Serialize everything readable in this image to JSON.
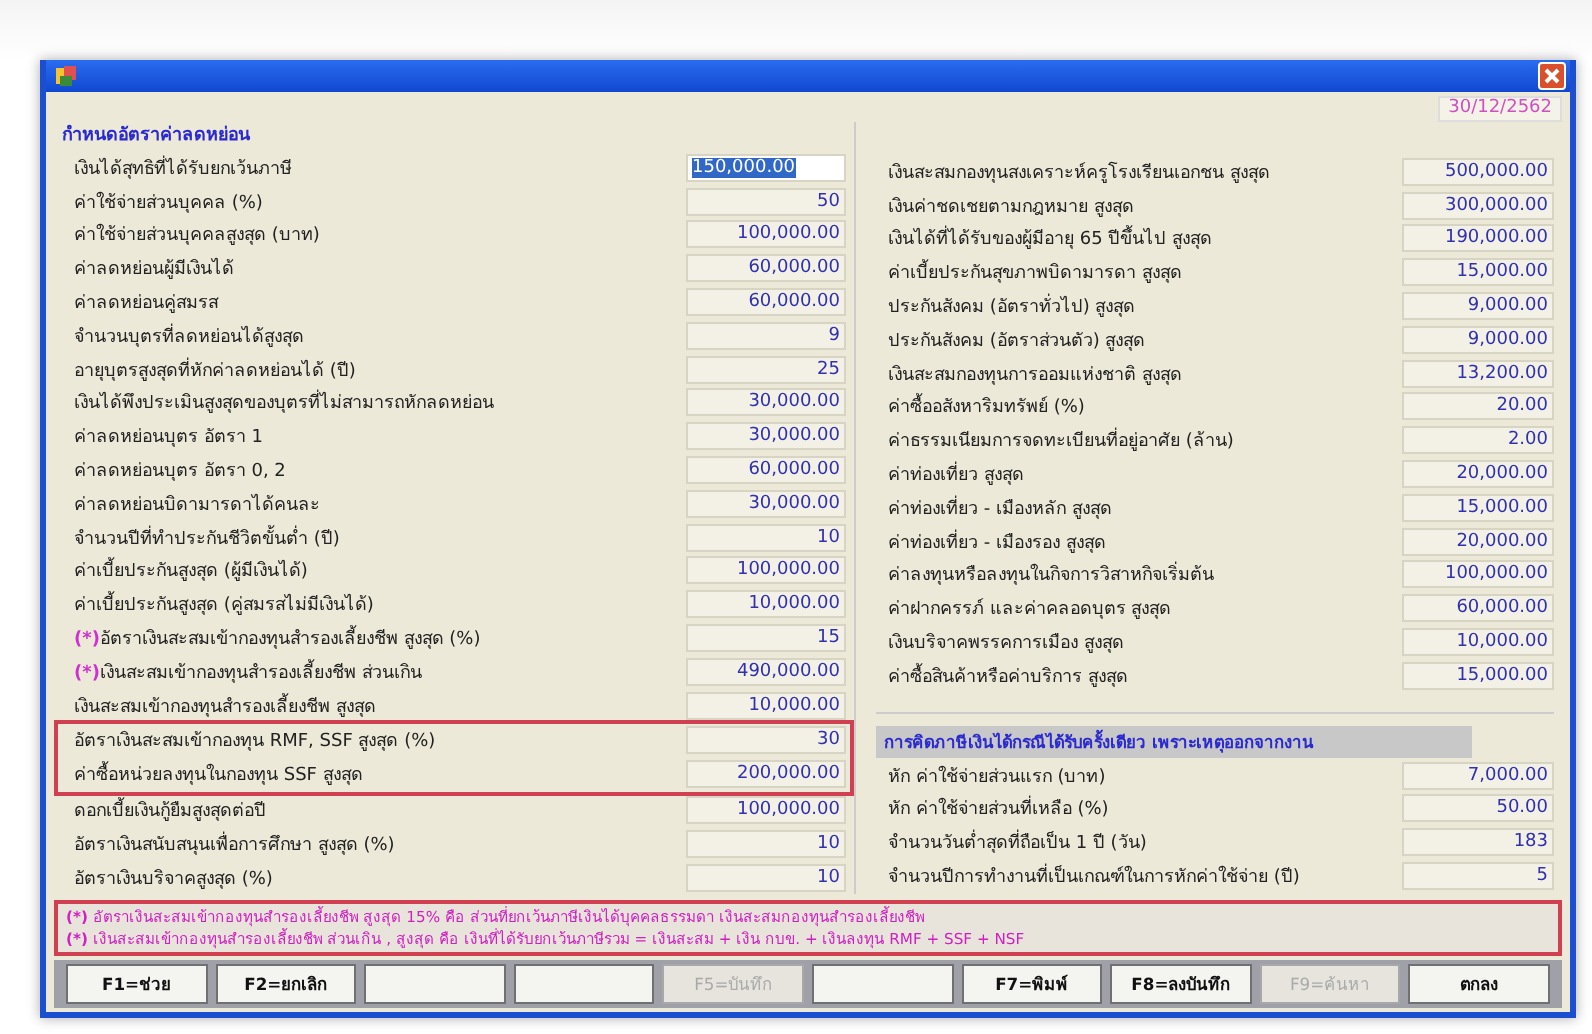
{
  "window": {
    "date": "30/12/2562"
  },
  "left_panel": {
    "title": "กำหนดอัตราค่าลดหย่อน",
    "rows": [
      {
        "label": "เงินได้สุทธิที่ได้รับยกเว้นภาษี",
        "value": "150,000.00",
        "selected": true
      },
      {
        "label": "ค่าใช้จ่ายส่วนบุคคล (%)",
        "value": "50",
        "selected": false
      },
      {
        "label": "ค่าใช้จ่ายส่วนบุคคลสูงสุด (บาท)",
        "value": "100,000.00",
        "selected": false
      },
      {
        "label": "ค่าลดหย่อนผู้มีเงินได้",
        "value": "60,000.00",
        "selected": false
      },
      {
        "label": "ค่าลดหย่อนคู่สมรส",
        "value": "60,000.00",
        "selected": false
      },
      {
        "label": "จำนวนบุตรที่ลดหย่อนได้สูงสุด",
        "value": "9",
        "selected": false
      },
      {
        "label": "อายุบุตรสูงสุดที่หักค่าลดหย่อนได้ (ปี)",
        "value": "25",
        "selected": false
      },
      {
        "label": "เงินได้พึงประเมินสูงสุดของบุตรที่ไม่สามารถหักลดหย่อน",
        "value": "30,000.00",
        "selected": false
      },
      {
        "label": "ค่าลดหย่อนบุตร อัตรา 1",
        "value": "30,000.00",
        "selected": false
      },
      {
        "label": "ค่าลดหย่อนบุตร อัตรา 0, 2",
        "value": "60,000.00",
        "selected": false
      },
      {
        "label": "ค่าลดหย่อนบิดามารดาได้คนละ",
        "value": "30,000.00",
        "selected": false
      },
      {
        "label": "จำนวนปีที่ทำประกันชีวิตขั้นต่ำ (ปี)",
        "value": "10",
        "selected": false
      },
      {
        "label": "ค่าเบี้ยประกันสูงสุด (ผู้มีเงินได้)",
        "value": "100,000.00",
        "selected": false
      },
      {
        "label": "ค่าเบี้ยประกันสูงสุด (คู่สมรสไม่มีเงินได้)",
        "value": "10,000.00",
        "selected": false
      },
      {
        "mark": "(*)",
        "label": "อัตราเงินสะสมเข้ากองทุนสำรองเลี้ยงชีพ สูงสุด (%)",
        "value": "15",
        "selected": false
      },
      {
        "mark": "(*)",
        "label": "เงินสะสมเข้ากองทุนสำรองเลี้ยงชีพ ส่วนเกิน",
        "value": "490,000.00",
        "selected": false
      },
      {
        "label": "เงินสะสมเข้ากองทุนสำรองเลี้ยงชีพ สูงสุด",
        "value": "10,000.00",
        "selected": false
      },
      {
        "kind": "highlight_group",
        "rows": [
          {
            "label": "อัตราเงินสะสมเข้ากองทุน RMF, SSF สูงสุด (%)",
            "value": "30",
            "selected": false
          },
          {
            "label": "ค่าซื้อหน่วยลงทุนในกองทุน SSF สูงสุด",
            "value": "200,000.00",
            "selected": false
          }
        ]
      },
      {
        "label": "ดอกเบี้ยเงินกู้ยืมสูงสุดต่อปี",
        "value": "100,000.00",
        "selected": false
      },
      {
        "label": "อัตราเงินสนับสนุนเพื่อการศึกษา สูงสุด (%)",
        "value": "10",
        "selected": false
      },
      {
        "label": "อัตราเงินบริจาคสูงสุด (%)",
        "value": "10",
        "selected": false
      }
    ]
  },
  "right_panel": {
    "rows": [
      {
        "kind": "field",
        "label": "เงินสะสมกองทุนสงเคราะห์ครูโรงเรียนเอกชน สูงสุด",
        "value": "500,000.00"
      },
      {
        "kind": "field",
        "label": "เงินค่าชดเชยตามกฎหมาย สูงสุด",
        "value": "300,000.00"
      },
      {
        "kind": "field",
        "label": "เงินได้ที่ได้รับของผู้มีอายุ 65 ปีขึ้นไป สูงสุด",
        "value": "190,000.00"
      },
      {
        "kind": "field",
        "label": "ค่าเบี้ยประกันสุขภาพบิดามารดา สูงสุด",
        "value": "15,000.00"
      },
      {
        "kind": "field",
        "label": "ประกันสังคม (อัตราทั่วไป) สูงสุด",
        "value": "9,000.00"
      },
      {
        "kind": "field",
        "label": "ประกันสังคม (อัตราส่วนตัว) สูงสุด",
        "value": "9,000.00"
      },
      {
        "kind": "field",
        "label": "เงินสะสมกองทุนการออมแห่งชาติ สูงสุด",
        "value": "13,200.00"
      },
      {
        "kind": "field",
        "label": "ค่าซื้ออสังหาริมทรัพย์ (%)",
        "value": "20.00"
      },
      {
        "kind": "field",
        "label": "ค่าธรรมเนียมการจดทะเบียนที่อยู่อาศัย (ล้าน)",
        "value": "2.00"
      },
      {
        "kind": "field",
        "label": "ค่าท่องเที่ยว สูงสุด",
        "value": "20,000.00"
      },
      {
        "kind": "field",
        "label": "ค่าท่องเที่ยว - เมืองหลัก สูงสุด",
        "value": "15,000.00"
      },
      {
        "kind": "field",
        "label": "ค่าท่องเที่ยว - เมืองรอง สูงสุด",
        "value": "20,000.00"
      },
      {
        "kind": "field",
        "label": "ค่าลงทุนหรือลงทุนในกิจการวิสาหกิจเริ่มต้น",
        "value": "100,000.00"
      },
      {
        "kind": "field",
        "label": "ค่าฝากครรภ์ และค่าคลอดบุตร สูงสุด",
        "value": "60,000.00"
      },
      {
        "kind": "field",
        "label": "เงินบริจาคพรรคการเมือง สูงสุด",
        "value": "10,000.00"
      },
      {
        "kind": "field",
        "label": "ค่าซื้อสินค้าหรือค่าบริการ สูงสุด",
        "value": "15,000.00"
      },
      {
        "kind": "divider"
      },
      {
        "kind": "header",
        "label": "การคิดภาษีเงินได้กรณีได้รับครั้งเดียว เพราะเหตุออกจากงาน"
      },
      {
        "kind": "field",
        "label": "หัก ค่าใช้จ่ายส่วนแรก (บาท)",
        "value": "7,000.00"
      },
      {
        "kind": "field",
        "label": "หัก ค่าใช้จ่ายส่วนที่เหลือ (%)",
        "value": "50.00"
      },
      {
        "kind": "field",
        "label": "จำนวนวันต่ำสุดที่ถือเป็น 1 ปี (วัน)",
        "value": "183"
      },
      {
        "kind": "field",
        "label": "จำนวนปีการทำงานที่เป็นเกณฑ์ในการหักค่าใช้จ่าย (ปี)",
        "value": "5"
      }
    ]
  },
  "notes": [
    {
      "mark": "(*)",
      "text": "อัตราเงินสะสมเข้ากองทุนสำรองเลี้ยงชีพ สูงสุด 15% คือ ส่วนที่ยกเว้นภาษีเงินได้บุคคลธรรมดา เงินสะสมกองทุนสำรองเลี้ยงชีพ"
    },
    {
      "mark": "(*)",
      "text": "เงินสะสมเข้ากองทุนสำรองเลี้ยงชีพ ส่วนเกิน , สูงสุด คือ เงินที่ได้รับยกเว้นภาษีรวม = เงินสะสม + เงิน กบข. + เงินลงทุน RMF + SSF + NSF"
    }
  ],
  "buttons": [
    {
      "label": "F1=ช่วย",
      "disabled": false
    },
    {
      "label": "F2=ยกเลิก",
      "disabled": false
    },
    {
      "disabled": false
    },
    {
      "disabled": false
    },
    {
      "label": "F5=บันทึก",
      "disabled": true
    },
    {
      "disabled": false
    },
    {
      "label": "F7=พิมพ์",
      "disabled": false
    },
    {
      "label": "F8=ลงบันทึก",
      "disabled": false
    },
    {
      "label": "F9=ค้นหา",
      "disabled": true
    },
    {
      "label": "ตกลง",
      "disabled": false
    }
  ]
}
